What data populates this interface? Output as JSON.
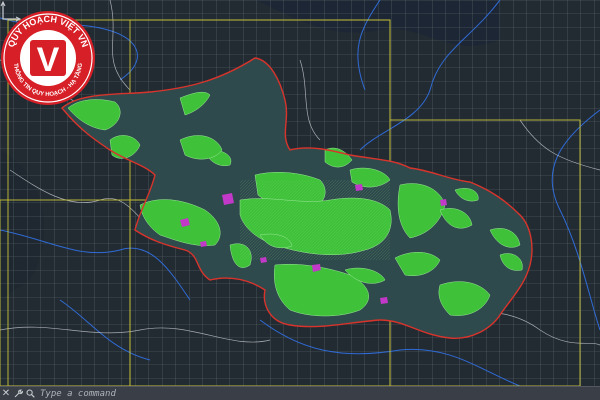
{
  "app": {
    "name": "AutoCAD model space (planning map drawing)"
  },
  "colors": {
    "background": "#222a31",
    "grid": "#5f6f70",
    "frame": "#c8c23a",
    "boundary": "#d8342c",
    "forest": "#3fc23a",
    "water": "#2f6bd6",
    "roads": "#c9ced3",
    "magenta": "#c238c8",
    "badge_red": "#d61f26"
  },
  "watermark": {
    "letter": "V",
    "arc_top": "QUY HOẠCH VIỆT VN",
    "arc_bottom": "THÔNG TIN QUY HOẠCH - HẠ TẦNG"
  },
  "command_line": {
    "placeholder": "Type a command",
    "close_icon": "close-icon",
    "customize_icon": "wrench-icon",
    "search_icon": "search-icon"
  }
}
